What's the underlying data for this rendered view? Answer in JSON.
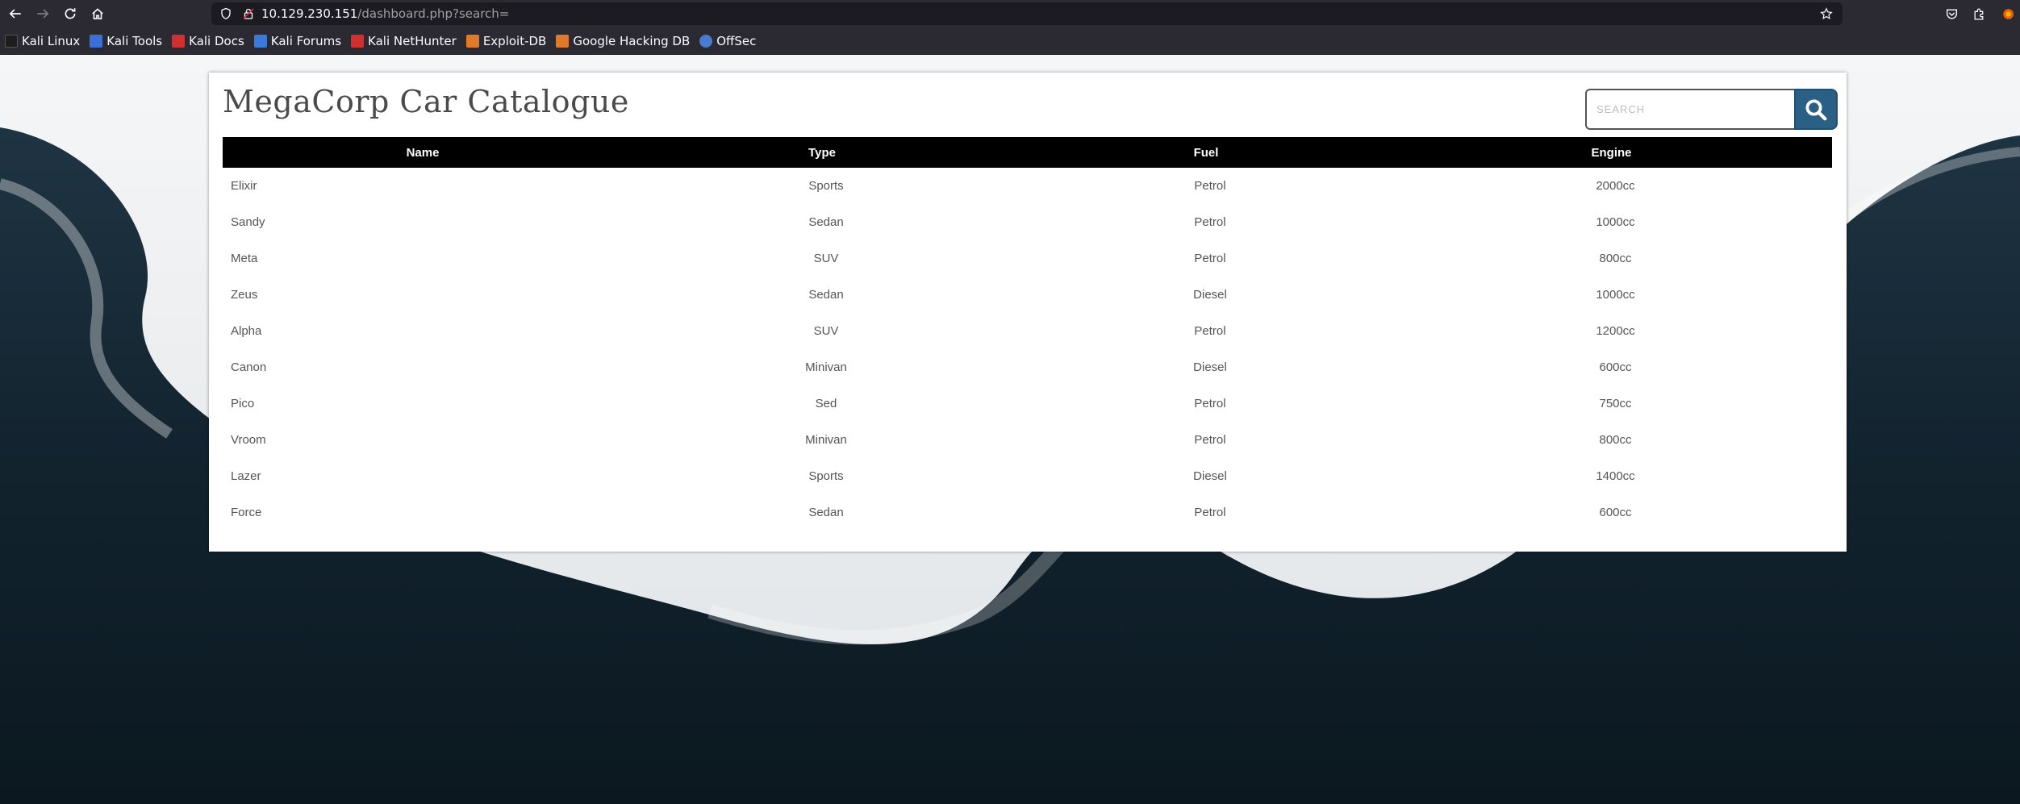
{
  "browser": {
    "url_host": "10.129.230.151",
    "url_path": "/dashboard.php?search=",
    "bookmarks": [
      {
        "label": "Kali Linux",
        "color": "#1d1d1d"
      },
      {
        "label": "Kali Tools",
        "color": "#3b6fd6"
      },
      {
        "label": "Kali Docs",
        "color": "#d0302f"
      },
      {
        "label": "Kali Forums",
        "color": "#3b78d8"
      },
      {
        "label": "Kali NetHunter",
        "color": "#d0302f"
      },
      {
        "label": "Exploit-DB",
        "color": "#e07a2a"
      },
      {
        "label": "Google Hacking DB",
        "color": "#e07a2a"
      },
      {
        "label": "OffSec",
        "color": "#4a7bd0"
      }
    ]
  },
  "page": {
    "title": "MegaCorp Car Catalogue",
    "search": {
      "placeholder": "SEARCH",
      "value": ""
    },
    "accent": "#2a5f86"
  },
  "table": {
    "headers": {
      "name": "Name",
      "type": "Type",
      "fuel": "Fuel",
      "engine": "Engine"
    },
    "rows": [
      {
        "name": "Elixir",
        "type": "Sports",
        "fuel": "Petrol",
        "engine": "2000cc"
      },
      {
        "name": "Sandy",
        "type": "Sedan",
        "fuel": "Petrol",
        "engine": "1000cc"
      },
      {
        "name": "Meta",
        "type": "SUV",
        "fuel": "Petrol",
        "engine": "800cc"
      },
      {
        "name": "Zeus",
        "type": "Sedan",
        "fuel": "Diesel",
        "engine": "1000cc"
      },
      {
        "name": "Alpha",
        "type": "SUV",
        "fuel": "Petrol",
        "engine": "1200cc"
      },
      {
        "name": "Canon",
        "type": "Minivan",
        "fuel": "Diesel",
        "engine": "600cc"
      },
      {
        "name": "Pico",
        "type": "Sed",
        "fuel": "Petrol",
        "engine": "750cc"
      },
      {
        "name": "Vroom",
        "type": "Minivan",
        "fuel": "Petrol",
        "engine": "800cc"
      },
      {
        "name": "Lazer",
        "type": "Sports",
        "fuel": "Diesel",
        "engine": "1400cc"
      },
      {
        "name": "Force",
        "type": "Sedan",
        "fuel": "Petrol",
        "engine": "600cc"
      }
    ]
  }
}
